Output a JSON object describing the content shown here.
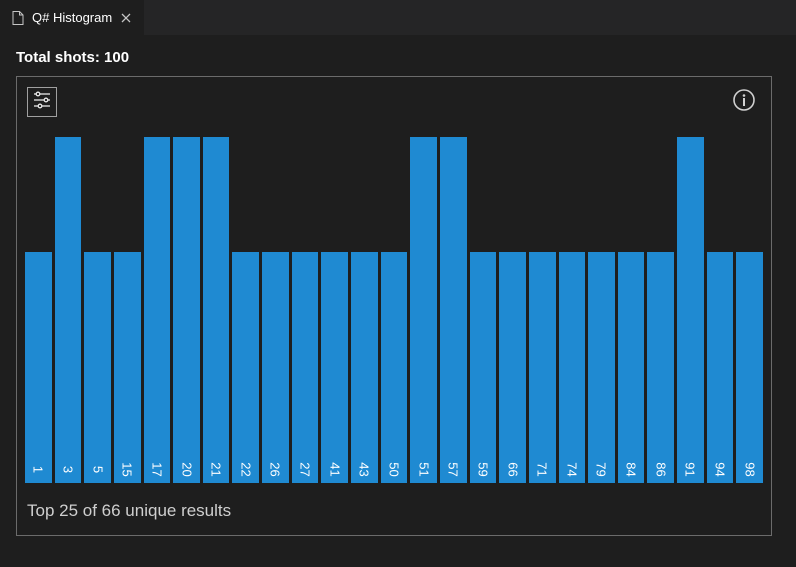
{
  "tab": {
    "title": "Q# Histogram"
  },
  "header": {
    "shots_label": "Total shots: 100"
  },
  "footer": {
    "summary": "Top 25 of 66 unique results"
  },
  "chart_data": {
    "type": "bar",
    "title": "Q# Histogram",
    "xlabel": "",
    "ylabel": "",
    "ylim": [
      0,
      3
    ],
    "categories": [
      "1",
      "3",
      "5",
      "15",
      "17",
      "20",
      "21",
      "22",
      "26",
      "27",
      "41",
      "43",
      "50",
      "51",
      "57",
      "59",
      "66",
      "71",
      "74",
      "79",
      "84",
      "86",
      "91",
      "94",
      "98"
    ],
    "values": [
      2,
      3,
      2,
      2,
      3,
      3,
      3,
      2,
      2,
      2,
      2,
      2,
      2,
      3,
      3,
      2,
      2,
      2,
      2,
      2,
      2,
      2,
      3,
      2,
      2
    ]
  }
}
